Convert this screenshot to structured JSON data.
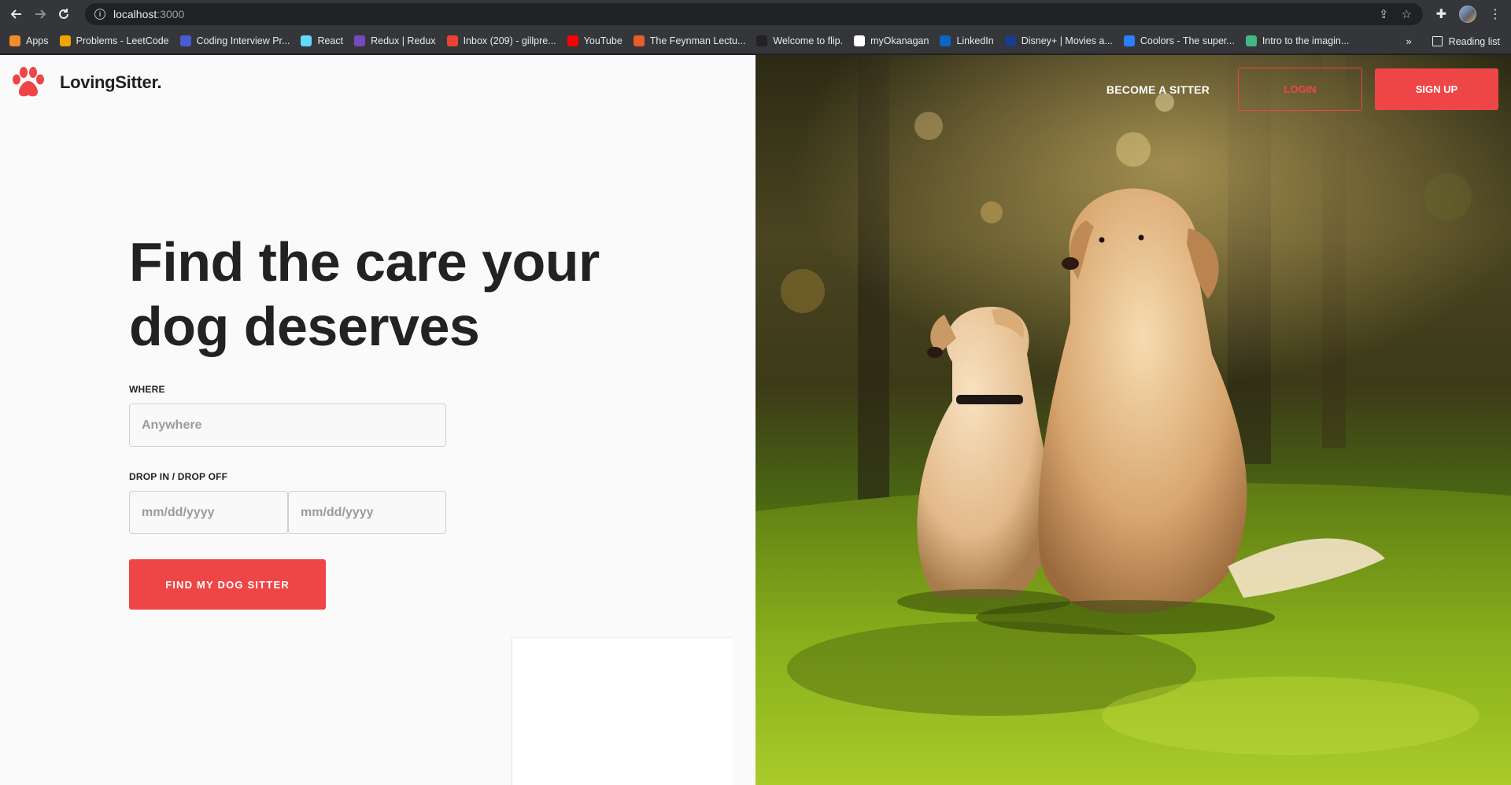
{
  "browser": {
    "url_host": "localhost",
    "url_port": ":3000",
    "bookmarks": [
      {
        "label": "Apps",
        "icon": "apps-grid-icon",
        "color": "#f28b2a"
      },
      {
        "label": "Problems - LeetCode",
        "icon": "leetcode-icon",
        "color": "#f0a500"
      },
      {
        "label": "Coding Interview Pr...",
        "icon": "algoexpert-icon",
        "color": "#4a5bd6"
      },
      {
        "label": "React",
        "icon": "react-icon",
        "color": "#61dafb"
      },
      {
        "label": "Redux | Redux",
        "icon": "redux-icon",
        "color": "#764abc"
      },
      {
        "label": "Inbox (209) - gillpre...",
        "icon": "gmail-icon",
        "color": "#ea4335"
      },
      {
        "label": "YouTube",
        "icon": "youtube-icon",
        "color": "#ff0000"
      },
      {
        "label": "The Feynman Lectu...",
        "icon": "feynman-icon",
        "color": "#e85d2a"
      },
      {
        "label": "Welcome to flip.",
        "icon": "flip-icon",
        "color": "#222222"
      },
      {
        "label": "myOkanagan",
        "icon": "okanagan-icon",
        "color": "#ffffff"
      },
      {
        "label": "LinkedIn",
        "icon": "linkedin-icon",
        "color": "#0a66c2"
      },
      {
        "label": "Disney+ | Movies a...",
        "icon": "disney-icon",
        "color": "#1a3c8f"
      },
      {
        "label": "Coolors - The super...",
        "icon": "coolors-icon",
        "color": "#2b7fff"
      },
      {
        "label": "Intro to the imagin...",
        "icon": "vuejs-icon",
        "color": "#41b883"
      }
    ],
    "reading_list": "Reading list"
  },
  "brand": {
    "name": "LovingSitter.",
    "accent": "#ee4646"
  },
  "nav": {
    "become_sitter": "BECOME A SITTER",
    "login": "LOGIN",
    "signup": "SIGN UP"
  },
  "hero": {
    "title": "Find the care your dog deserves"
  },
  "form": {
    "where_label": "WHERE",
    "where_placeholder": "Anywhere",
    "dates_label": "DROP IN / DROP OFF",
    "drop_in_placeholder": "mm/dd/yyyy",
    "drop_off_placeholder": "mm/dd/yyyy",
    "submit_label": "FIND MY DOG SITTER"
  }
}
